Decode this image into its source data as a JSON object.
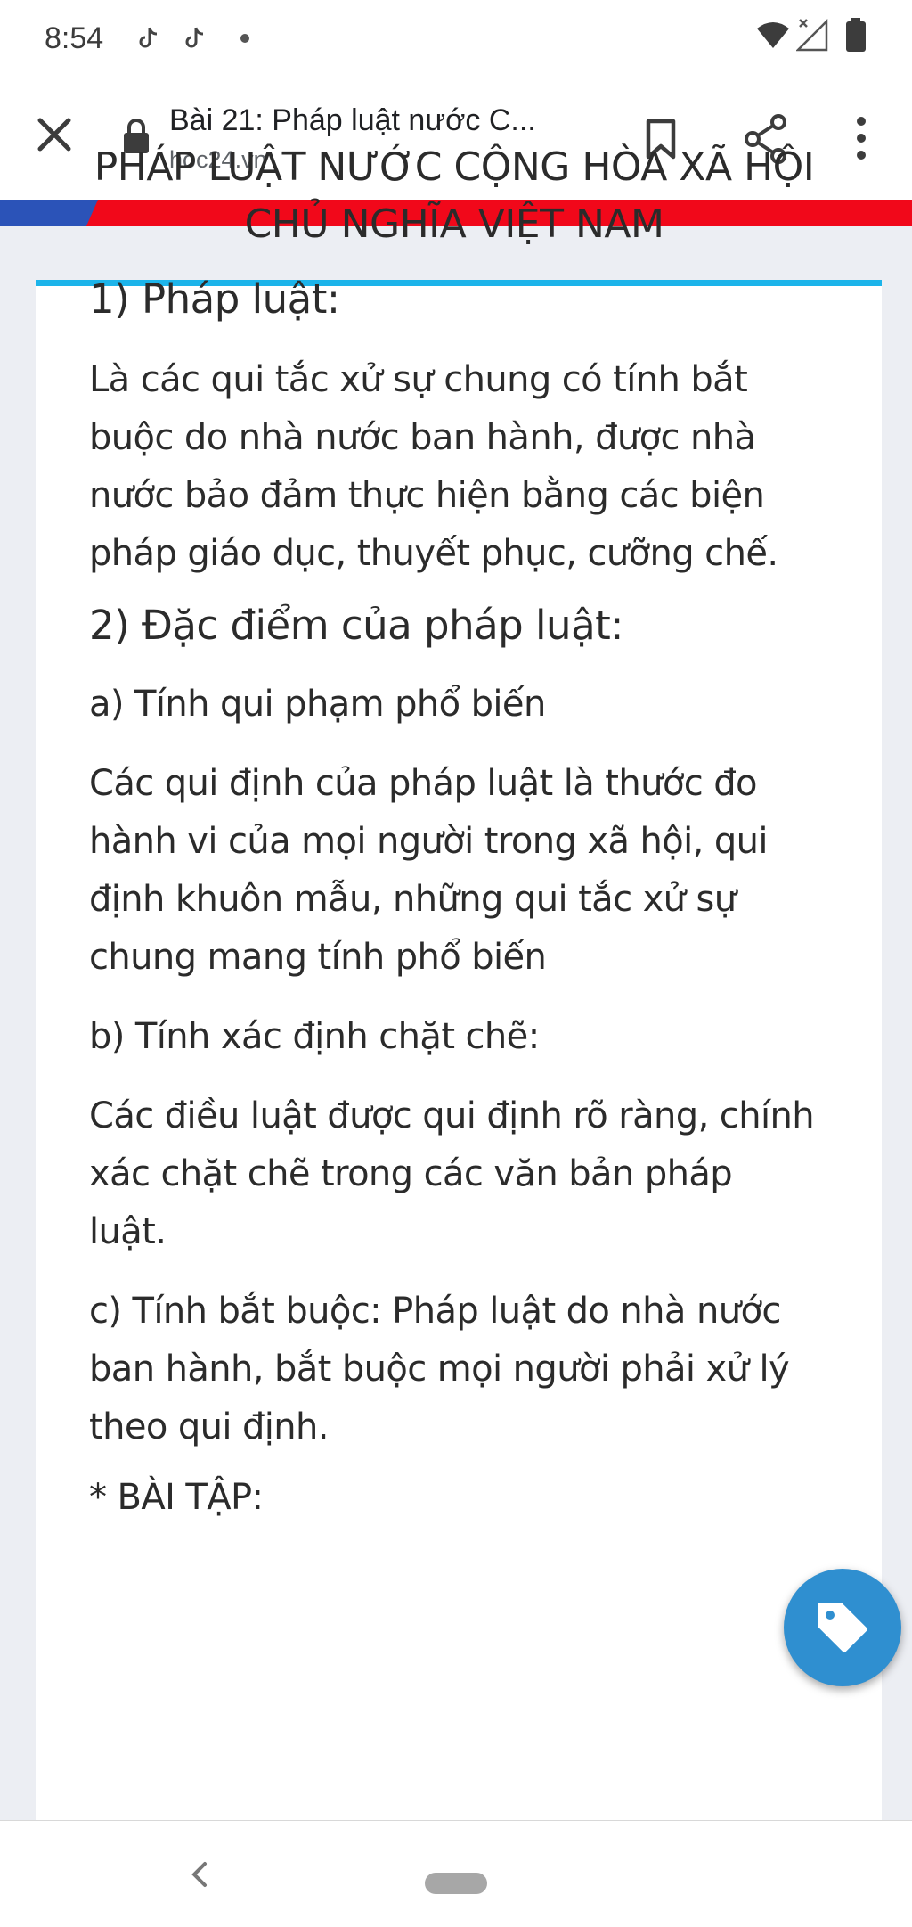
{
  "status_bar": {
    "time": "8:54",
    "icons": [
      "tiktok-icon",
      "tiktok-icon",
      "dot-icon",
      "wifi-icon",
      "signal-icon",
      "battery-icon"
    ]
  },
  "toolbar": {
    "title": "Bài 21: Pháp luật nước C...",
    "url": "hoc24.vn",
    "icons": [
      "close-icon",
      "lock-icon",
      "bookmark-icon",
      "share-icon",
      "more-icon"
    ]
  },
  "colors": {
    "banner_red": "#f1081a",
    "banner_blue": "#2b53b8",
    "card_accent": "#1cb4ea",
    "fab": "#2f8fd0"
  },
  "article": {
    "title": "PHÁP LUẬT NƯỚC CỘNG HÒA XÃ HỘI CHỦ NGHĨA VIỆT NAM",
    "h1": "1) Pháp luật:",
    "p1": "Là các qui tắc xử sự chung có tính bắt buộc do nhà nước ban hành, được nhà nước bảo đảm thực hiện bằng các biện pháp giáo dục, thuyết phục, cưỡng chế.",
    "h2": "2) Đặc điểm của pháp luật:",
    "sub_a": "a) Tính qui phạm phổ biến",
    "p_a": "Các qui định của pháp luật là thước đo hành vi của mọi người trong xã hội, qui định khuôn mẫu, những qui tắc xử sự chung mang tính phổ biến",
    "sub_b": "b) Tính xác định chặt chẽ:",
    "p_b": "Các điều luật được qui định rõ ràng, chính xác chặt chẽ trong các văn bản pháp luật.",
    "p_c": "c) Tính bắt buộc: Pháp luật do nhà nước ban hành, bắt buộc mọi người phải xử lý theo qui định.",
    "exercise": "* BÀI TẬP:"
  },
  "fab": {
    "icon": "tag-icon"
  },
  "nav": {
    "icons": [
      "back-icon",
      "home-pill"
    ]
  }
}
